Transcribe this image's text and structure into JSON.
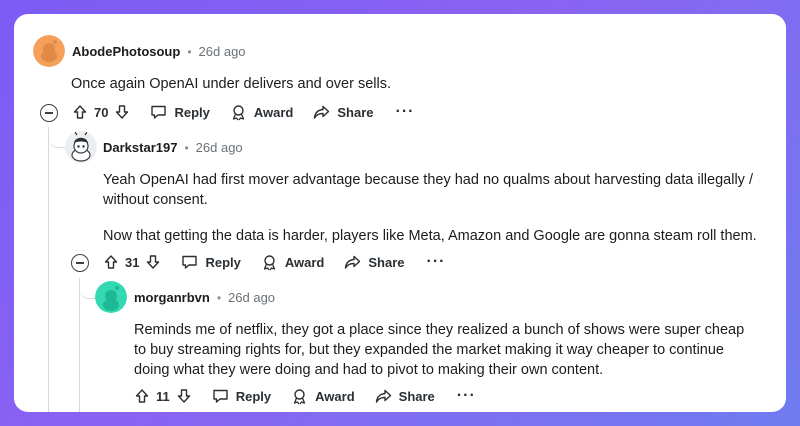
{
  "comments": [
    {
      "author": "AbodePhotosoup",
      "separator": "•",
      "time": "26d ago",
      "paragraphs": [
        "Once again OpenAI under delivers and over sells."
      ],
      "score": "70",
      "reply_label": "Reply",
      "award_label": "Award",
      "share_label": "Share",
      "more_label": "···"
    },
    {
      "author": "Darkstar197",
      "separator": "•",
      "time": "26d ago",
      "paragraphs": [
        "Yeah OpenAI had first mover advantage because they had no qualms about harvesting data illegally / without consent.",
        "Now that getting the data is harder, players like Meta, Amazon and Google are gonna steam roll them."
      ],
      "score": "31",
      "reply_label": "Reply",
      "award_label": "Award",
      "share_label": "Share",
      "more_label": "···"
    },
    {
      "author": "morganrbvn",
      "separator": "•",
      "time": "26d ago",
      "paragraphs": [
        "Reminds me of netflix, they got a place since they realized a bunch of shows were super cheap to buy streaming rights for, but they expanded the market making it way cheaper to continue doing what they were doing and had to pivot to making their own content."
      ],
      "score": "11",
      "reply_label": "Reply",
      "award_label": "Award",
      "share_label": "Share",
      "more_label": "···"
    }
  ],
  "colors": {
    "background_gradient_start": "#7b5cf5",
    "background_gradient_end": "#6f7cf0",
    "avatar_orange": "#f5a05a",
    "avatar_green": "#33d9b2",
    "text": "#1c1c1c",
    "muted": "#6b7176"
  },
  "icons": {
    "upvote": "arrow-up-icon",
    "downvote": "arrow-down-icon",
    "reply": "speech-bubble-icon",
    "award": "award-ribbon-icon",
    "share": "share-arrow-icon",
    "collapse": "minus-circle-icon"
  }
}
